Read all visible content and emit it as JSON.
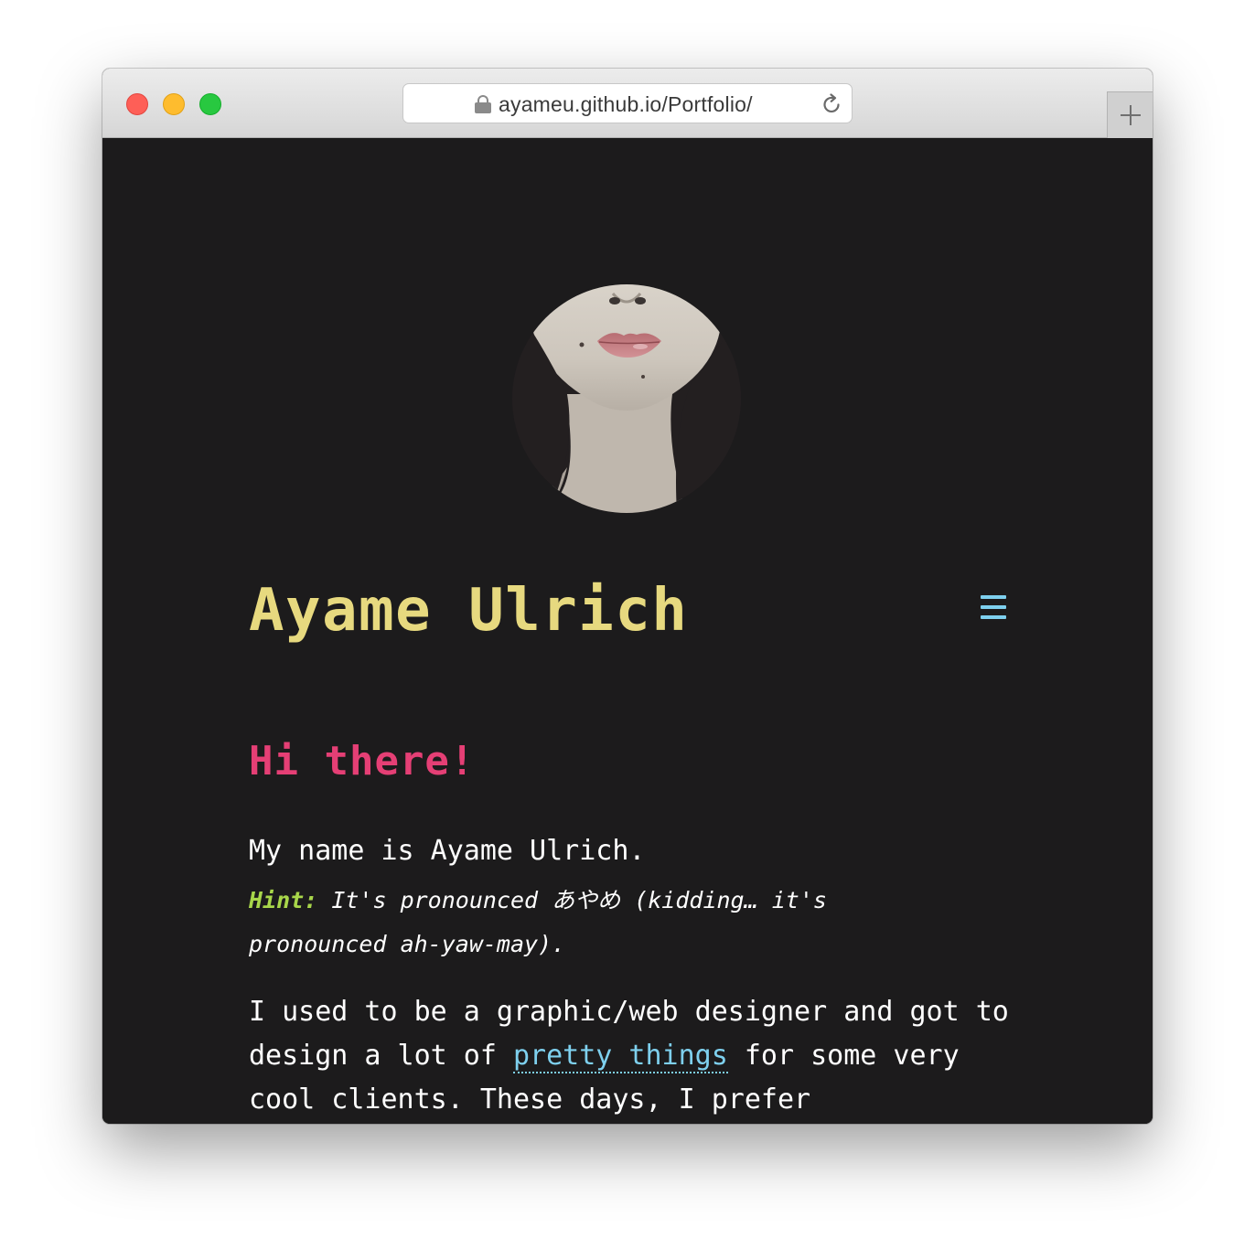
{
  "browser": {
    "url": "ayameu.github.io/Portfolio/",
    "lock_icon": "lock-icon",
    "reload_icon": "reload-icon",
    "new_tab_icon": "plus-icon"
  },
  "site": {
    "title": "Ayame Ulrich",
    "menu_icon": "hamburger-menu-icon",
    "colors": {
      "background": "#1c1b1c",
      "title": "#e7d97f",
      "heading": "#e53f75",
      "hint": "#a8d64a",
      "link": "#7ed0ee"
    }
  },
  "content": {
    "greeting": "Hi there!",
    "intro": "My name is Ayame Ulrich.",
    "hint_label": "Hint:",
    "hint_text": "It's pronounced あやめ (kidding… it's pronounced ah-yaw-may).",
    "about_before": "I used to be a graphic/web designer and got to design a lot of ",
    "about_link": "pretty things",
    "about_after": " for some very cool clients. These days, I prefer"
  }
}
